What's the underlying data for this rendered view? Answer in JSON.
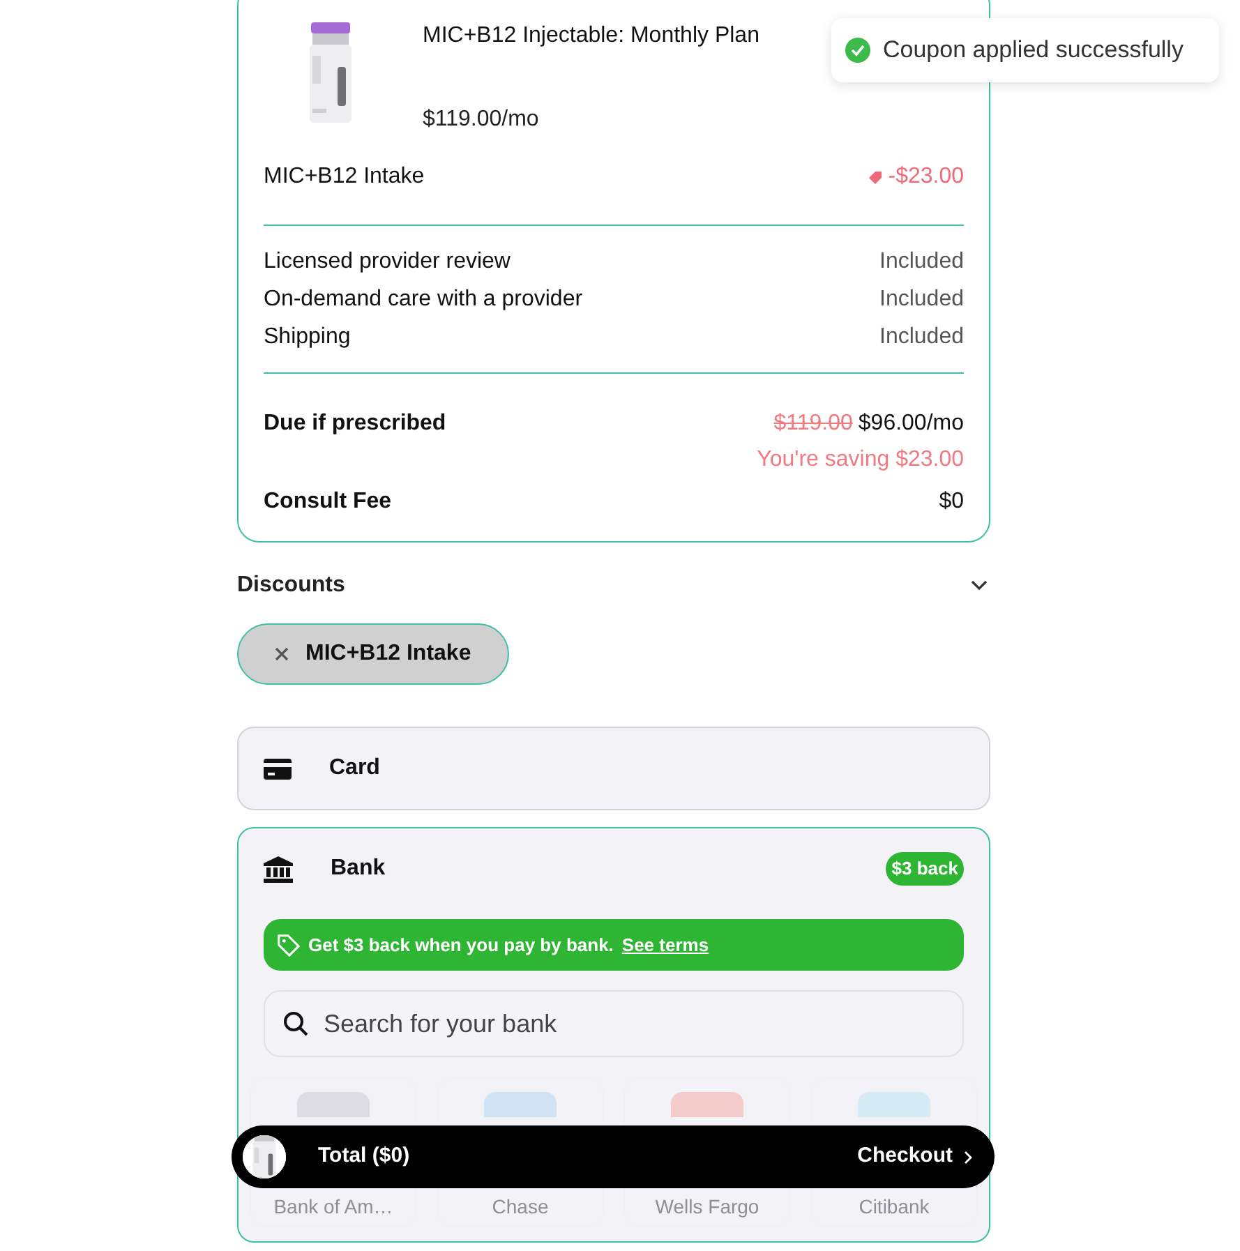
{
  "toast": {
    "message": "Coupon applied successfully"
  },
  "order": {
    "product": {
      "title": "MIC+B12 Injectable: Monthly Plan",
      "price": "$119.00/mo"
    },
    "discount_line": {
      "label": "MIC+B12 Intake",
      "amount": "-$23.00"
    },
    "included": [
      {
        "label": "Licensed provider review",
        "value": "Included"
      },
      {
        "label": "On-demand care with a provider",
        "value": "Included"
      },
      {
        "label": "Shipping",
        "value": "Included"
      }
    ],
    "due": {
      "label": "Due if prescribed",
      "original_price": "$119.00",
      "price": "$96.00/mo",
      "saving": "You're saving $23.00"
    },
    "consult_fee": {
      "label": "Consult Fee",
      "value": "$0"
    }
  },
  "discounts": {
    "title": "Discounts",
    "applied": [
      {
        "label": "MIC+B12 Intake"
      }
    ]
  },
  "payment_methods": [
    {
      "kind": "card",
      "label": "Card",
      "selected": false
    },
    {
      "kind": "bank",
      "label": "Bank",
      "selected": true,
      "badge": "$3 back"
    }
  ],
  "bank_panel": {
    "promo": "Get $3 back when you pay by bank.",
    "promo_link": "See terms",
    "search_placeholder": "Search for your bank",
    "banks": [
      {
        "name": "Bank of Am…",
        "color": "#dcdce2"
      },
      {
        "name": "Chase",
        "color": "#cfe3f5"
      },
      {
        "name": "Wells Fargo",
        "color": "#f5cccc"
      },
      {
        "name": "Citibank",
        "color": "#d5ecf7"
      }
    ]
  },
  "checkout_bar": {
    "total": "Total ($0)",
    "action": "Checkout"
  }
}
